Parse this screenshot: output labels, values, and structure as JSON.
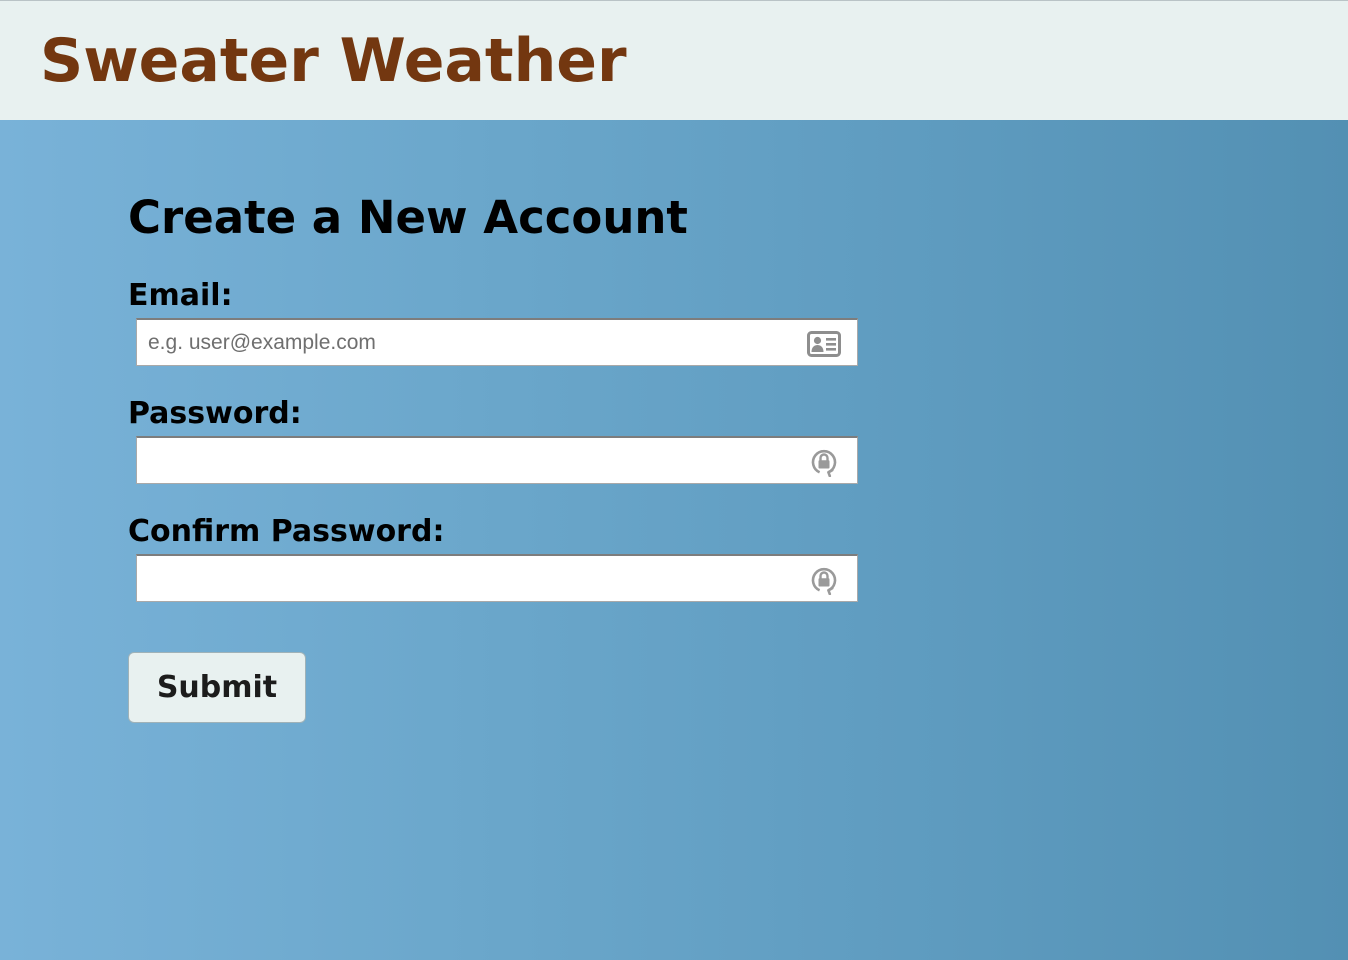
{
  "header": {
    "title": "Sweater Weather"
  },
  "form": {
    "title": "Create a New Account",
    "email": {
      "label": "Email:",
      "value": "",
      "placeholder": "e.g. user@example.com",
      "icon": "contact-card-icon"
    },
    "password": {
      "label": "Password:",
      "value": "",
      "placeholder": "",
      "icon": "password-key-icon"
    },
    "confirm_password": {
      "label": "Confirm Password:",
      "value": "",
      "placeholder": "",
      "icon": "password-key-icon"
    },
    "submit_label": "Submit"
  },
  "colors": {
    "brand": "#733710",
    "header_bg": "#e8f1f0",
    "page_gradient_start": "#79b2d8",
    "page_gradient_end": "#5390b3",
    "button_bg": "#e8f1f0"
  }
}
